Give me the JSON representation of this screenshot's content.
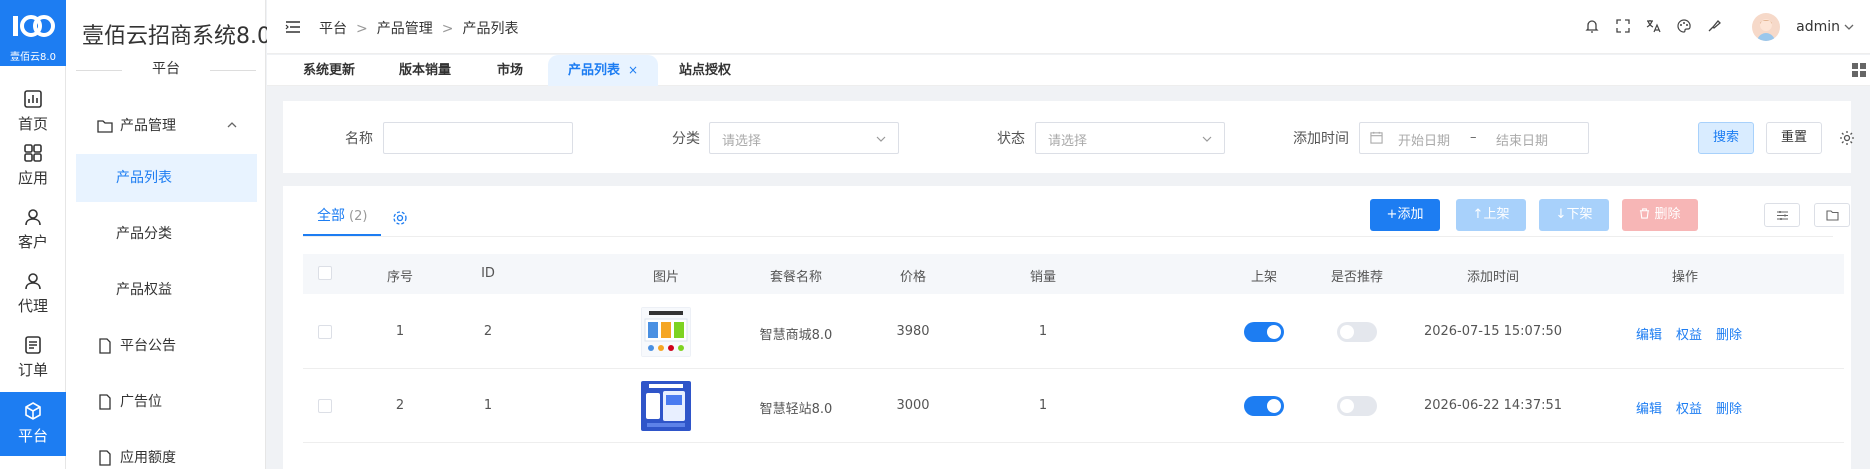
{
  "brand": {
    "logo_caption": "壹佰云8.0",
    "system_name": "壹佰云招商系统8.0",
    "section_title": "平台"
  },
  "rail": [
    {
      "label": "首页",
      "icon": "chart-icon"
    },
    {
      "label": "应用",
      "icon": "grid-icon"
    },
    {
      "label": "客户",
      "icon": "user-icon"
    },
    {
      "label": "代理",
      "icon": "user-icon"
    },
    {
      "label": "订单",
      "icon": "list-icon"
    },
    {
      "label": "平台",
      "icon": "box-icon",
      "active": true
    }
  ],
  "sidebar": {
    "group": {
      "label": "产品管理",
      "icon": "folder-icon"
    },
    "sub_items": [
      {
        "label": "产品列表",
        "active": true
      },
      {
        "label": "产品分类"
      },
      {
        "label": "产品权益"
      }
    ],
    "items": [
      {
        "label": "平台公告",
        "icon": "file-icon"
      },
      {
        "label": "广告位",
        "icon": "file-icon"
      },
      {
        "label": "应用额度",
        "icon": "file-icon"
      }
    ]
  },
  "header": {
    "breadcrumb": [
      "平台",
      "产品管理",
      "产品列表"
    ],
    "breadcrumb_sep": ">",
    "user": "admin"
  },
  "tabs": [
    {
      "label": "系统更新"
    },
    {
      "label": "版本销量"
    },
    {
      "label": "市场"
    },
    {
      "label": "产品列表",
      "active": true,
      "close": "×"
    },
    {
      "label": "站点授权"
    }
  ],
  "filters": {
    "name": {
      "label": "名称",
      "value": ""
    },
    "category": {
      "label": "分类",
      "placeholder": "请选择"
    },
    "status": {
      "label": "状态",
      "placeholder": "请选择"
    },
    "added_time": {
      "label": "添加时间",
      "start_placeholder": "开始日期",
      "range_sep": "–",
      "end_placeholder": "结束日期"
    },
    "search_label": "搜索",
    "reset_label": "重置"
  },
  "list": {
    "subtab_label": "全部",
    "subtab_count": "(2)",
    "actions": {
      "add": "+添加",
      "up": "↑上架",
      "down": "↓下架",
      "delete": "删除"
    }
  },
  "table": {
    "columns": [
      "序号",
      "ID",
      "图片",
      "套餐名称",
      "价格",
      "销量",
      "上架",
      "是否推荐",
      "添加时间",
      "操作"
    ],
    "rows": [
      {
        "index": "1",
        "id": "2",
        "name": "智慧商城8.0",
        "price": "3980",
        "sales": "1",
        "listed": true,
        "recommended": false,
        "added": "2026-07-15 15:07:50"
      },
      {
        "index": "2",
        "id": "1",
        "name": "智慧轻站8.0",
        "price": "3000",
        "sales": "1",
        "listed": true,
        "recommended": false,
        "added": "2026-06-22 14:37:51"
      }
    ],
    "ops": {
      "edit": "编辑",
      "rights": "权益",
      "delete": "删除"
    }
  },
  "colors": {
    "primary": "#1d7df2",
    "primary_light": "#e8f3ff",
    "danger_light": "#f7b6b6"
  }
}
